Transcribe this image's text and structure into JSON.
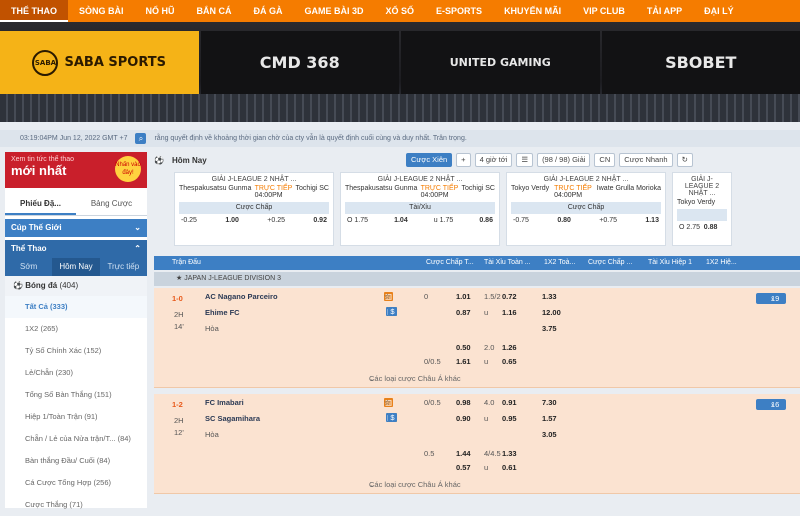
{
  "nav": [
    "THỂ THAO",
    "SÒNG BÀI",
    "NỔ HŨ",
    "BẮN CÁ",
    "ĐÁ GÀ",
    "GAME BÀI 3D",
    "XỔ SỐ",
    "E-SPORTS",
    "KHUYẾN MÃI",
    "VIP CLUB",
    "TẢI APP",
    "ĐẠI LÝ"
  ],
  "providers": [
    "SABA SPORTS",
    "CMD 368",
    "UNITED GAMING",
    "SBOBET"
  ],
  "info": {
    "time": "03:19:04PM Jun 12, 2022 GMT +7",
    "marquee": "rằng quyết định về khoảng thời gian chờ của cty vẫn là quyết định cuối cùng và duy nhất. Trân trọng."
  },
  "promo": {
    "line1": "Xem tin tức thể thao",
    "line2": "mới nhất",
    "badge": "Nhấn vào đây!"
  },
  "left": {
    "tab1": "Phiếu Đặ...",
    "tab2": "Bảng Cược",
    "sec1": "Cúp Thế Giới",
    "sec2": "Thể Thao",
    "subtabs": [
      "Sớm",
      "Hôm Nay",
      "Trực tiếp"
    ],
    "sport": "Bóng đá",
    "sport_count": "(404)",
    "items": [
      {
        "l": "Tất Cả",
        "c": "(333)"
      },
      {
        "l": "1X2",
        "c": "(265)"
      },
      {
        "l": "Tỷ Số Chính Xác",
        "c": "(152)"
      },
      {
        "l": "Lẻ/Chẵn",
        "c": "(230)"
      },
      {
        "l": "Tổng Số Bàn Thắng",
        "c": "(151)"
      },
      {
        "l": "Hiệp 1/Toàn Trận",
        "c": "(91)"
      },
      {
        "l": "Chẵn / Lẻ của Nửa trận/T...",
        "c": "(84)"
      },
      {
        "l": "Bàn thắng Đầu/ Cuối",
        "c": "(84)"
      },
      {
        "l": "Cá Cược Tổng Hợp",
        "c": "(256)"
      },
      {
        "l": "Cược Thắng",
        "c": "(71)"
      }
    ]
  },
  "toolbar": {
    "title": "Hôm Nay",
    "btn1": "Cược Xiên",
    "btn2": "4 giờ tới",
    "btn3": "(98 / 98) Giải",
    "btn4": "CN",
    "btn5": "Cược Nhanh"
  },
  "cards": [
    {
      "league": "GIẢI J-LEAGUE 2 NHẬT ...",
      "t1": "Thespakusatsu Gunma",
      "live": "TRỰC TIẾP",
      "time": "04:00PM",
      "t2": "Tochigi SC",
      "bt": "Cược Chấp",
      "o": [
        "-0.25",
        "1.00",
        "+0.25",
        "0.92"
      ]
    },
    {
      "league": "GIẢI J-LEAGUE 2 NHẬT ...",
      "t1": "Thespakusatsu Gunma",
      "live": "TRỰC TIẾP",
      "time": "04:00PM",
      "t2": "Tochigi SC",
      "bt": "Tài/Xỉu",
      "o": [
        "O 1.75",
        "1.04",
        "u 1.75",
        "0.86"
      ]
    },
    {
      "league": "GIẢI J-LEAGUE 2 NHẬT ...",
      "t1": "Tokyo Verdy",
      "live": "TRỰC TIẾP",
      "time": "04:00PM",
      "t2": "Iwate Grulla Morioka",
      "bt": "Cược Chấp",
      "o": [
        "-0.75",
        "0.80",
        "+0.75",
        "1.13"
      ]
    },
    {
      "league": "GIẢI J-LEAGUE 2 NHẬT ...",
      "t1": "Tokyo Verdy",
      "live": "",
      "time": "",
      "t2": "",
      "bt": "",
      "o": [
        "O 2.75",
        "0.88",
        "",
        ""
      ]
    }
  ],
  "thead": [
    "Trận Đấu",
    "Cược Chấp T...",
    "Tài Xỉu Toàn ...",
    "1X2 Toà...",
    "Cược Chấp ...",
    "Tài Xỉu Hiệp 1",
    "1X2 Hiệ..."
  ],
  "league": "JAPAN J-LEAGUE DIVISION 3",
  "matches": [
    {
      "score": "1-0",
      "half": "2H",
      "min": "14'",
      "t1": "AC Nagano Parceiro",
      "t2": "Ehime FC",
      "draw": "Hòa",
      "more": "Các loại cược Châu Á khác",
      "count": "19",
      "rows": [
        [
          "0",
          "1.01",
          "1.5/2",
          "0.72",
          "1.33"
        ],
        [
          "",
          "0.87",
          "u",
          "1.16",
          "12.00"
        ],
        [
          "",
          "",
          "",
          "",
          "3.75"
        ],
        [
          "",
          "0.50",
          "2.0",
          "1.26",
          ""
        ],
        [
          "0/0.5",
          "1.61",
          "u",
          "0.65",
          ""
        ]
      ]
    },
    {
      "score": "1-2",
      "half": "2H",
      "min": "12'",
      "t1": "FC Imabari",
      "t2": "SC Sagamihara",
      "draw": "Hòa",
      "more": "Các loại cược Châu Á khác",
      "count": "16",
      "rows": [
        [
          "0/0.5",
          "0.98",
          "4.0",
          "0.91",
          "7.30"
        ],
        [
          "",
          "0.90",
          "u",
          "0.95",
          "1.57"
        ],
        [
          "",
          "",
          "",
          "",
          "3.05"
        ],
        [
          "0.5",
          "1.44",
          "4/4.5",
          "1.33",
          ""
        ],
        [
          "",
          "0.57",
          "u",
          "0.61",
          ""
        ]
      ]
    }
  ]
}
